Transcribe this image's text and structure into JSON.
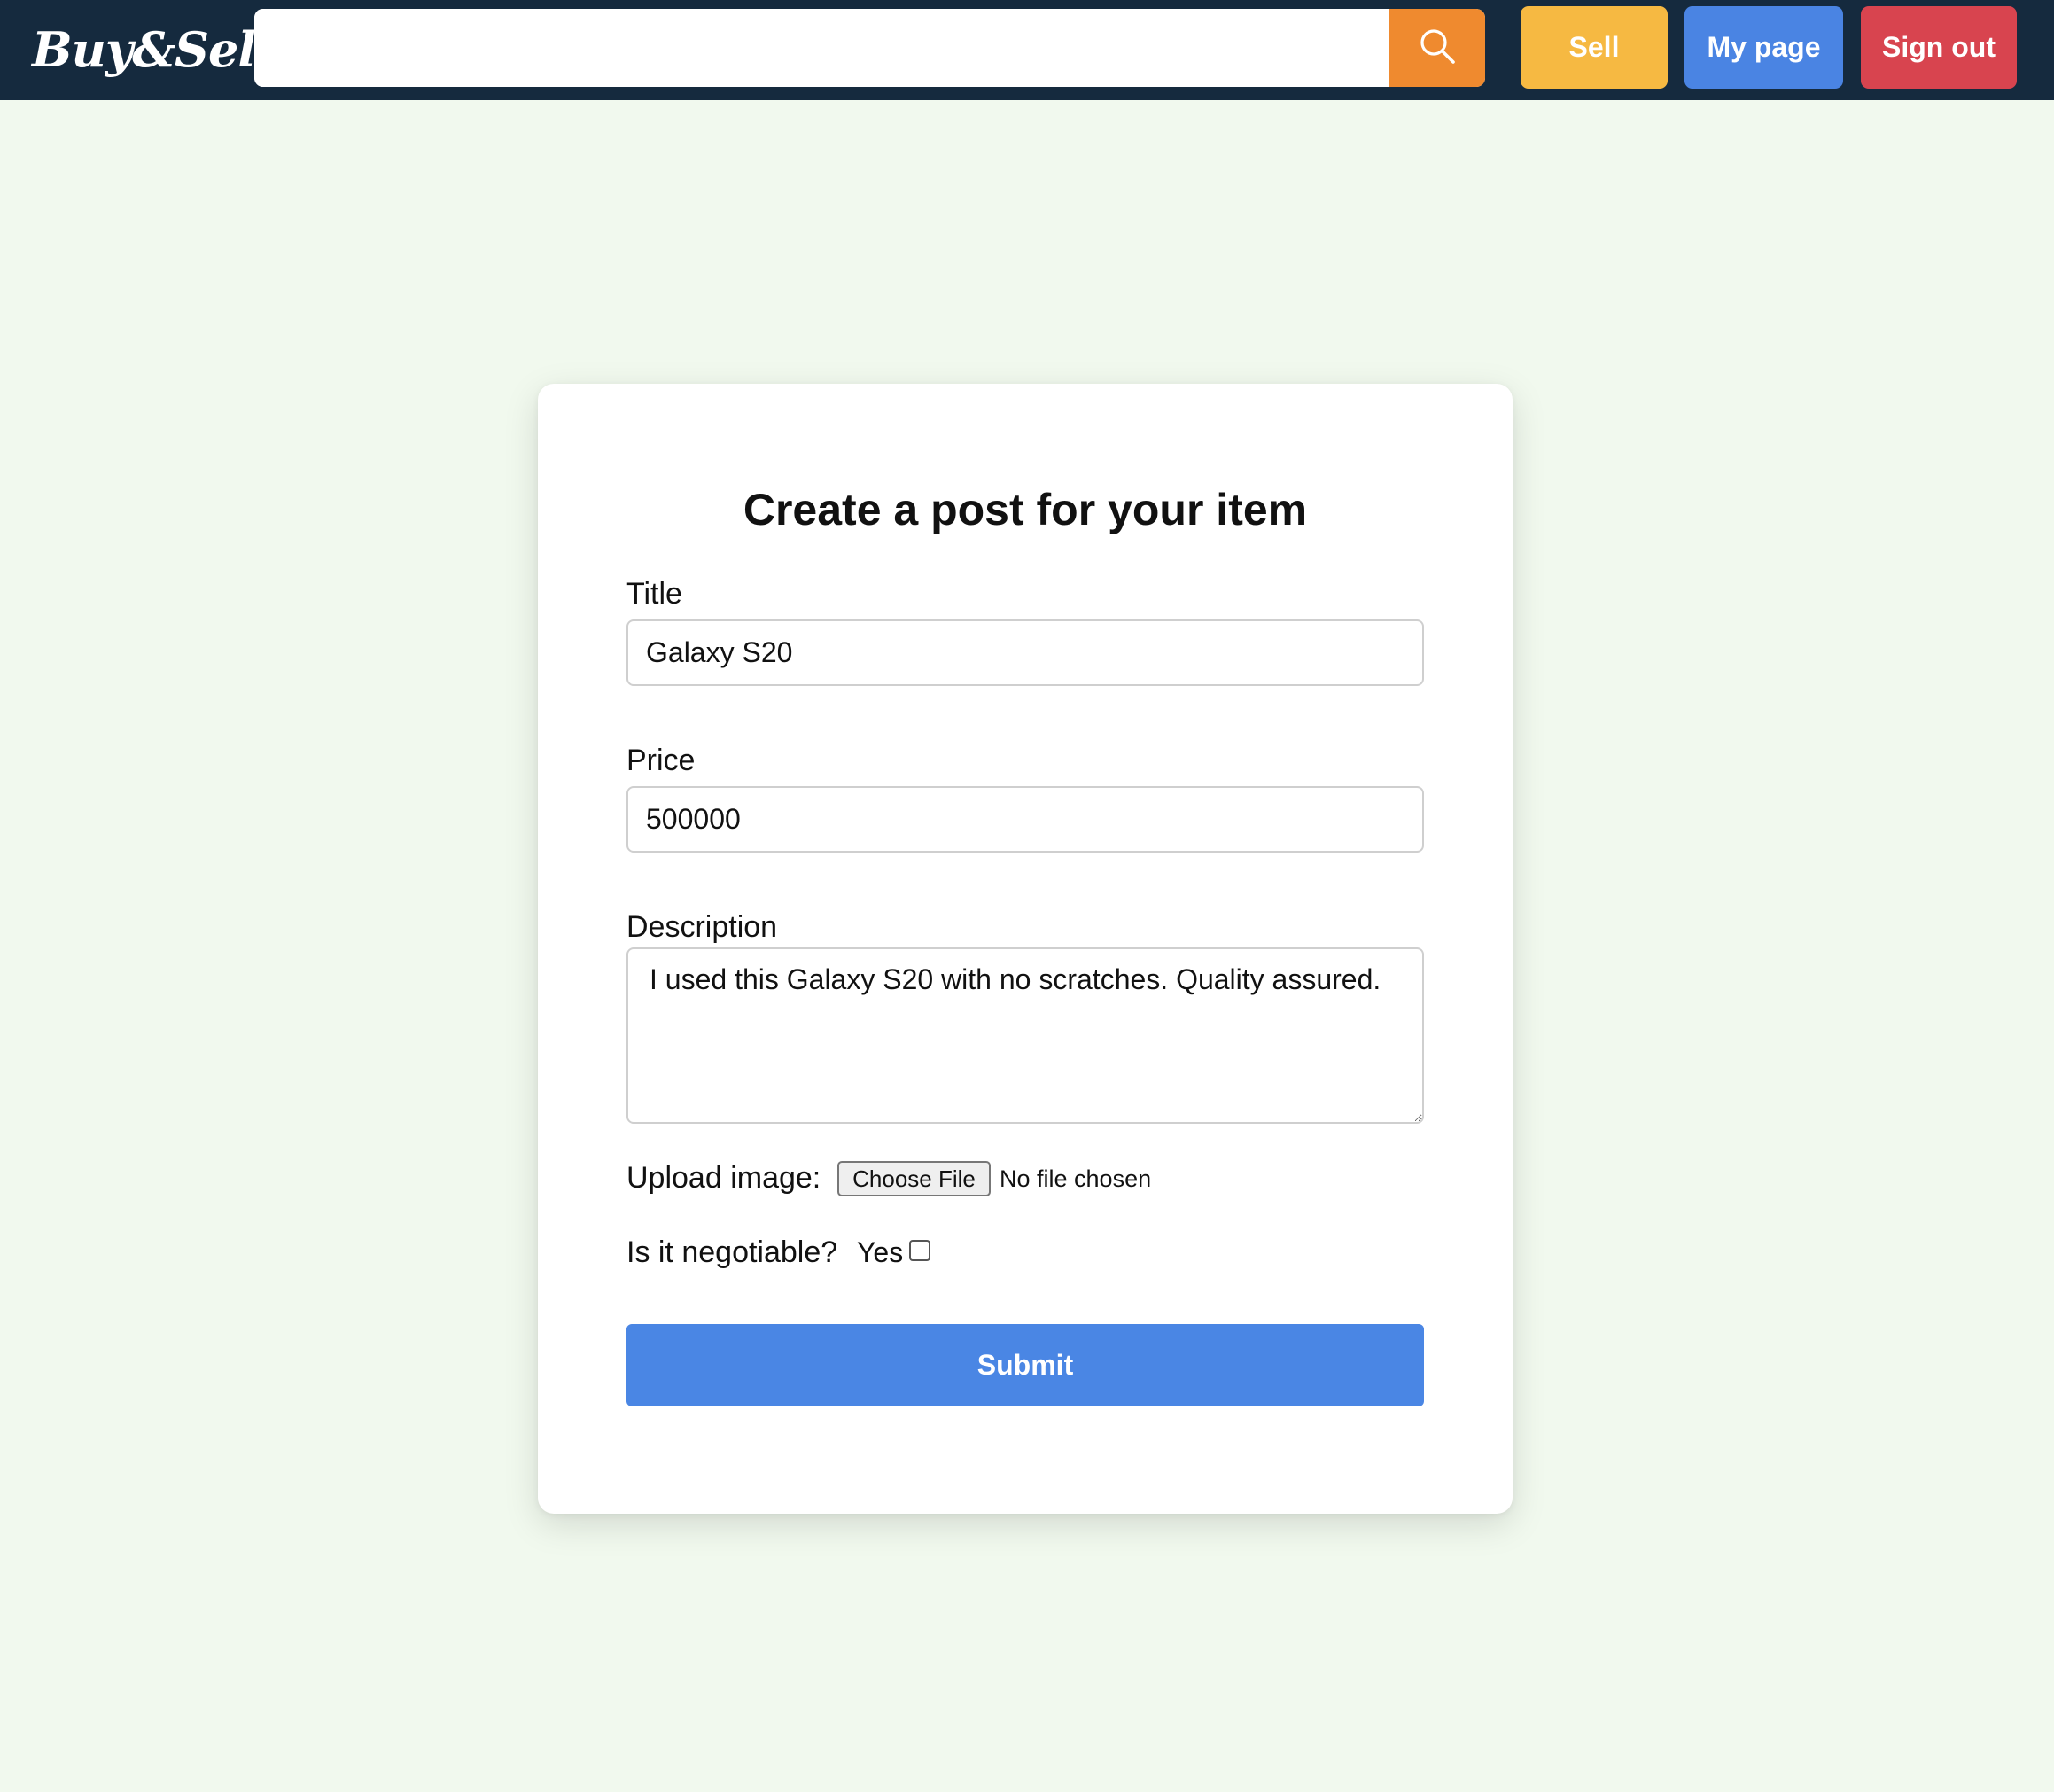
{
  "header": {
    "logo_text": "Buy&Sell",
    "search": {
      "value": "",
      "placeholder": ""
    },
    "search_icon": "search-icon",
    "buttons": {
      "sell": "Sell",
      "my_page": "My page",
      "sign_out": "Sign out"
    }
  },
  "form": {
    "title": "Create a post for your item",
    "fields": {
      "title_label": "Title",
      "title_value": "Galaxy S20",
      "price_label": "Price",
      "price_value": "500000",
      "description_label": "Description",
      "description_value": "I used this Galaxy S20 with no scratches. Quality assured."
    },
    "upload": {
      "label": "Upload image:",
      "button": "Choose File",
      "status": "No file chosen"
    },
    "negotiable": {
      "label": "Is it negotiable?",
      "option": "Yes",
      "checked": false
    },
    "submit": "Submit"
  },
  "colors": {
    "topbar": "#152a3e",
    "background": "#f1f9ee",
    "search_button": "#ef8a2f",
    "sell": "#f6b942",
    "my_page": "#4a84e3",
    "sign_out": "#d8444f",
    "submit": "#4a86e4"
  }
}
